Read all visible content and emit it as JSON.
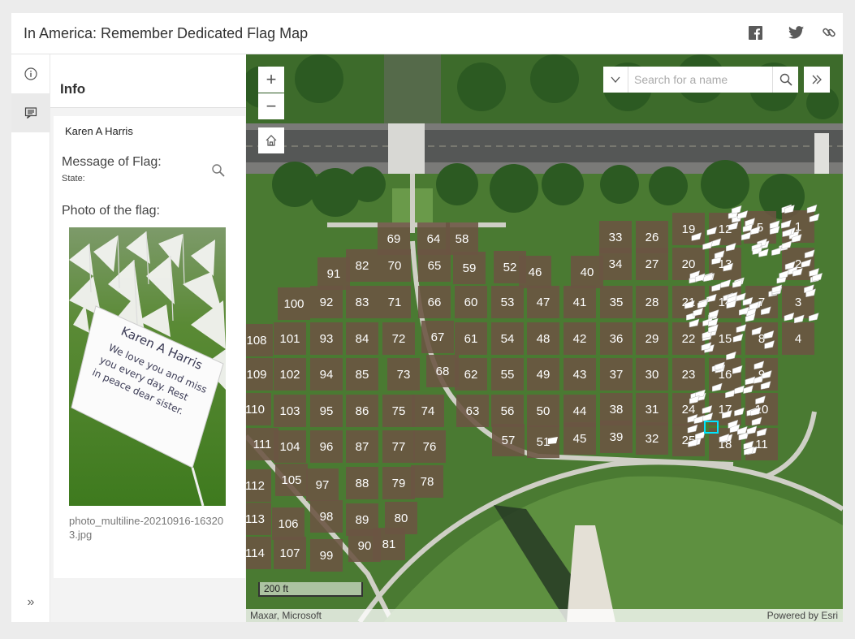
{
  "header": {
    "title": "In America: Remember Dedicated Flag Map"
  },
  "rail": {
    "items": [
      {
        "icon": "info-icon"
      },
      {
        "icon": "popup-icon"
      }
    ],
    "collapse_icon": "chevrons-right-icon",
    "collapse_glyph": "»"
  },
  "panel": {
    "title": "Info",
    "feature": {
      "name": "Karen A Harris",
      "message_label": "Message of Flag:",
      "state_label": "State:",
      "photo_label": "Photo of the flag:",
      "photo_caption": "photo_multiline-20210916-163203.jpg",
      "photo_handwriting": [
        "Karen A Harris",
        "We love you and miss",
        "you every day. Rest",
        "in peace dear sister."
      ]
    }
  },
  "map": {
    "zoom_in_glyph": "+",
    "zoom_out_glyph": "−",
    "search_placeholder": "Search for a name",
    "scale_text": "200 ft",
    "attribution_left": "Maxar, Microsoft",
    "attribution_right": "Powered by Esri",
    "plots": [
      {
        "label": "69",
        "col": "c",
        "row": 0
      },
      {
        "label": "64",
        "col": "c",
        "row": 0
      },
      {
        "label": "58",
        "col": "c",
        "row": 0
      },
      {
        "label": "33",
        "col": "c",
        "row": 0
      },
      {
        "label": "26",
        "col": "c",
        "row": 0
      },
      {
        "label": "19",
        "col": "c",
        "row": 0
      },
      {
        "label": "12",
        "col": "c",
        "row": 0
      },
      {
        "label": "5",
        "col": "c",
        "row": 0
      },
      {
        "label": "1",
        "col": "c",
        "row": 0
      },
      {
        "label": "91"
      },
      {
        "label": "82"
      },
      {
        "label": "70"
      },
      {
        "label": "65"
      },
      {
        "label": "59"
      },
      {
        "label": "52"
      },
      {
        "label": "46"
      },
      {
        "label": "40"
      },
      {
        "label": "34"
      },
      {
        "label": "27"
      },
      {
        "label": "20"
      },
      {
        "label": "13"
      },
      {
        "label": "2"
      },
      {
        "label": "100"
      },
      {
        "label": "92"
      },
      {
        "label": "83"
      },
      {
        "label": "71"
      },
      {
        "label": "66"
      },
      {
        "label": "60"
      },
      {
        "label": "53"
      },
      {
        "label": "47"
      },
      {
        "label": "41"
      },
      {
        "label": "35"
      },
      {
        "label": "28"
      },
      {
        "label": "21"
      },
      {
        "label": "14"
      },
      {
        "label": "7"
      },
      {
        "label": "3"
      },
      {
        "label": "108"
      },
      {
        "label": "101"
      },
      {
        "label": "93"
      },
      {
        "label": "84"
      },
      {
        "label": "72"
      },
      {
        "label": "67"
      },
      {
        "label": "61"
      },
      {
        "label": "54"
      },
      {
        "label": "48"
      },
      {
        "label": "42"
      },
      {
        "label": "36"
      },
      {
        "label": "29"
      },
      {
        "label": "22"
      },
      {
        "label": "15"
      },
      {
        "label": "8"
      },
      {
        "label": "4"
      },
      {
        "label": "109"
      },
      {
        "label": "102"
      },
      {
        "label": "94"
      },
      {
        "label": "85"
      },
      {
        "label": "73"
      },
      {
        "label": "68"
      },
      {
        "label": "62"
      },
      {
        "label": "55"
      },
      {
        "label": "49"
      },
      {
        "label": "43"
      },
      {
        "label": "37"
      },
      {
        "label": "30"
      },
      {
        "label": "23"
      },
      {
        "label": "16"
      },
      {
        "label": "9"
      },
      {
        "label": "110"
      },
      {
        "label": "103"
      },
      {
        "label": "95"
      },
      {
        "label": "86"
      },
      {
        "label": "75"
      },
      {
        "label": "74"
      },
      {
        "label": "63"
      },
      {
        "label": "56"
      },
      {
        "label": "50"
      },
      {
        "label": "44"
      },
      {
        "label": "38"
      },
      {
        "label": "31"
      },
      {
        "label": "24"
      },
      {
        "label": "17"
      },
      {
        "label": "10"
      },
      {
        "label": "111"
      },
      {
        "label": "104"
      },
      {
        "label": "96"
      },
      {
        "label": "87"
      },
      {
        "label": "77"
      },
      {
        "label": "76"
      },
      {
        "label": "57"
      },
      {
        "label": "51"
      },
      {
        "label": "45"
      },
      {
        "label": "39"
      },
      {
        "label": "32"
      },
      {
        "label": "25"
      },
      {
        "label": "18"
      },
      {
        "label": "11"
      },
      {
        "label": "112"
      },
      {
        "label": "105"
      },
      {
        "label": "97"
      },
      {
        "label": "88"
      },
      {
        "label": "79"
      },
      {
        "label": "78"
      },
      {
        "label": "113"
      },
      {
        "label": "106"
      },
      {
        "label": "98"
      },
      {
        "label": "89"
      },
      {
        "label": "80"
      },
      {
        "label": "114"
      },
      {
        "label": "107"
      },
      {
        "label": "99"
      },
      {
        "label": "90"
      },
      {
        "label": "81"
      }
    ]
  }
}
